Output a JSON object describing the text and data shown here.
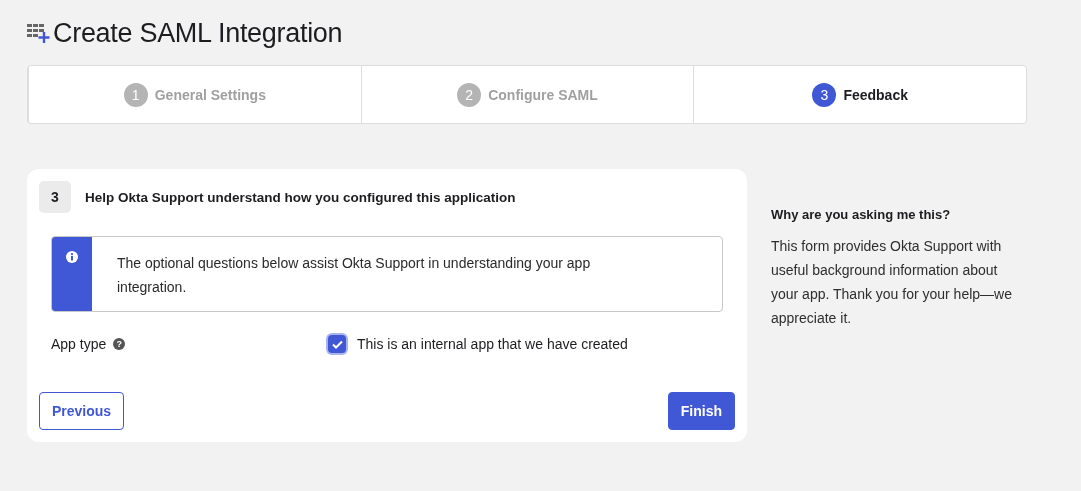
{
  "page": {
    "title": "Create SAML Integration"
  },
  "steps": [
    {
      "number": "1",
      "label": "General Settings",
      "selected": false
    },
    {
      "number": "2",
      "label": "Configure SAML",
      "selected": false
    },
    {
      "number": "3",
      "label": "Feedback",
      "selected": true
    }
  ],
  "section": {
    "number": "3",
    "title": "Help Okta Support understand how you configured this application",
    "info": "The optional questions below assist Okta Support in understanding your app integration.",
    "fields": [
      {
        "kind": "checkbox",
        "label": "App type",
        "help": "?",
        "option": "This is an internal app that we have created",
        "checked": true
      }
    ]
  },
  "buttons": [
    {
      "kind": "secondary",
      "label": "Previous"
    },
    {
      "kind": "primary",
      "label": "Finish"
    }
  ],
  "aside": {
    "title": "Why are you asking me this?",
    "body": "This form provides Okta Support with useful background information about your app. Thank you for your help—we appreciate it."
  }
}
